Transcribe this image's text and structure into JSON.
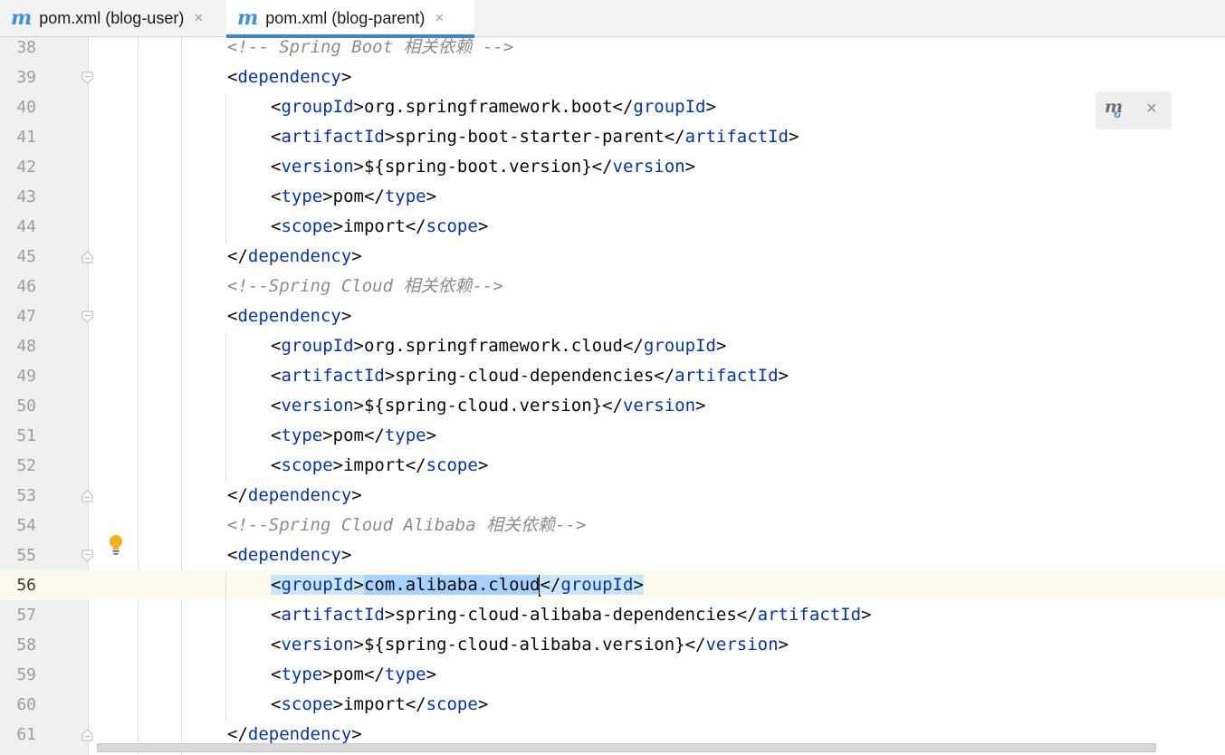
{
  "tabs": [
    {
      "icon": "maven-m-icon",
      "label": "pom.xml (blog-user)",
      "close": "×",
      "active": false
    },
    {
      "icon": "maven-m-icon",
      "label": "pom.xml (blog-parent)",
      "close": "×",
      "active": true
    }
  ],
  "maven_popup": {
    "icon": "maven-reload-icon",
    "close": "×"
  },
  "editor": {
    "current_line": 56,
    "lines": [
      {
        "n": "38",
        "parts": [
          {
            "t": "<!-- Spring Boot 相关依赖 -->",
            "c": "cm"
          }
        ]
      },
      {
        "n": "39",
        "parts": [
          {
            "t": "<",
            "c": ""
          },
          {
            "t": "dependency",
            "c": "t"
          },
          {
            "t": ">",
            "c": ""
          }
        ]
      },
      {
        "n": "40",
        "parts": [
          {
            "t": "<",
            "c": ""
          },
          {
            "t": "groupId",
            "c": "t"
          },
          {
            "t": ">org.springframework.boot</",
            "c": ""
          },
          {
            "t": "groupId",
            "c": "t"
          },
          {
            "t": ">",
            "c": ""
          }
        ]
      },
      {
        "n": "41",
        "parts": [
          {
            "t": "<",
            "c": ""
          },
          {
            "t": "artifactId",
            "c": "t"
          },
          {
            "t": ">spring-boot-starter-parent</",
            "c": ""
          },
          {
            "t": "artifactId",
            "c": "t"
          },
          {
            "t": ">",
            "c": ""
          }
        ]
      },
      {
        "n": "42",
        "parts": [
          {
            "t": "<",
            "c": ""
          },
          {
            "t": "version",
            "c": "t"
          },
          {
            "t": ">${spring-boot.version}</",
            "c": ""
          },
          {
            "t": "version",
            "c": "t"
          },
          {
            "t": ">",
            "c": ""
          }
        ]
      },
      {
        "n": "43",
        "parts": [
          {
            "t": "<",
            "c": ""
          },
          {
            "t": "type",
            "c": "t"
          },
          {
            "t": ">pom</",
            "c": ""
          },
          {
            "t": "type",
            "c": "t"
          },
          {
            "t": ">",
            "c": ""
          }
        ]
      },
      {
        "n": "44",
        "parts": [
          {
            "t": "<",
            "c": ""
          },
          {
            "t": "scope",
            "c": "t"
          },
          {
            "t": ">import</",
            "c": ""
          },
          {
            "t": "scope",
            "c": "t"
          },
          {
            "t": ">",
            "c": ""
          }
        ]
      },
      {
        "n": "45",
        "parts": [
          {
            "t": "</",
            "c": ""
          },
          {
            "t": "dependency",
            "c": "t"
          },
          {
            "t": ">",
            "c": ""
          }
        ]
      },
      {
        "n": "46",
        "parts": [
          {
            "t": "<!--Spring Cloud 相关依赖-->",
            "c": "cm"
          }
        ]
      },
      {
        "n": "47",
        "parts": [
          {
            "t": "<",
            "c": ""
          },
          {
            "t": "dependency",
            "c": "t"
          },
          {
            "t": ">",
            "c": ""
          }
        ]
      },
      {
        "n": "48",
        "parts": [
          {
            "t": "<",
            "c": ""
          },
          {
            "t": "groupId",
            "c": "t"
          },
          {
            "t": ">org.springframework.cloud</",
            "c": ""
          },
          {
            "t": "groupId",
            "c": "t"
          },
          {
            "t": ">",
            "c": ""
          }
        ]
      },
      {
        "n": "49",
        "parts": [
          {
            "t": "<",
            "c": ""
          },
          {
            "t": "artifactId",
            "c": "t"
          },
          {
            "t": ">spring-cloud-dependencies</",
            "c": ""
          },
          {
            "t": "artifactId",
            "c": "t"
          },
          {
            "t": ">",
            "c": ""
          }
        ]
      },
      {
        "n": "50",
        "parts": [
          {
            "t": "<",
            "c": ""
          },
          {
            "t": "version",
            "c": "t"
          },
          {
            "t": ">${spring-cloud.version}</",
            "c": ""
          },
          {
            "t": "version",
            "c": "t"
          },
          {
            "t": ">",
            "c": ""
          }
        ]
      },
      {
        "n": "51",
        "parts": [
          {
            "t": "<",
            "c": ""
          },
          {
            "t": "type",
            "c": "t"
          },
          {
            "t": ">pom</",
            "c": ""
          },
          {
            "t": "type",
            "c": "t"
          },
          {
            "t": ">",
            "c": ""
          }
        ]
      },
      {
        "n": "52",
        "parts": [
          {
            "t": "<",
            "c": ""
          },
          {
            "t": "scope",
            "c": "t"
          },
          {
            "t": ">import</",
            "c": ""
          },
          {
            "t": "scope",
            "c": "t"
          },
          {
            "t": ">",
            "c": ""
          }
        ]
      },
      {
        "n": "53",
        "parts": [
          {
            "t": "</",
            "c": ""
          },
          {
            "t": "dependency",
            "c": "t"
          },
          {
            "t": ">",
            "c": ""
          }
        ]
      },
      {
        "n": "54",
        "parts": [
          {
            "t": "<!--Spring Cloud Alibaba 相关依赖-->",
            "c": "cm"
          }
        ]
      },
      {
        "n": "55",
        "parts": [
          {
            "t": "<",
            "c": ""
          },
          {
            "t": "dependency",
            "c": "t"
          },
          {
            "t": ">",
            "c": ""
          }
        ]
      },
      {
        "n": "56",
        "parts": [
          {
            "t": "<",
            "c": "tag-hl"
          },
          {
            "t": "groupId",
            "c": "t tag-hl"
          },
          {
            "t": ">",
            "c": "tag-hl"
          },
          {
            "t": "com.alibaba.cloud",
            "c": "sel"
          },
          {
            "t": "",
            "c": "caret"
          },
          {
            "t": "</",
            "c": "tag-hl"
          },
          {
            "t": "groupId",
            "c": "t tag-hl"
          },
          {
            "t": ">",
            "c": "tag-hl"
          }
        ]
      },
      {
        "n": "57",
        "parts": [
          {
            "t": "<",
            "c": ""
          },
          {
            "t": "artifactId",
            "c": "t"
          },
          {
            "t": ">spring-cloud-alibaba-dependencies</",
            "c": ""
          },
          {
            "t": "artifactId",
            "c": "t"
          },
          {
            "t": ">",
            "c": ""
          }
        ]
      },
      {
        "n": "58",
        "parts": [
          {
            "t": "<",
            "c": ""
          },
          {
            "t": "version",
            "c": "t"
          },
          {
            "t": ">${spring-cloud-alibaba.version}</",
            "c": ""
          },
          {
            "t": "version",
            "c": "t"
          },
          {
            "t": ">",
            "c": ""
          }
        ]
      },
      {
        "n": "59",
        "parts": [
          {
            "t": "<",
            "c": ""
          },
          {
            "t": "type",
            "c": "t"
          },
          {
            "t": ">pom</",
            "c": ""
          },
          {
            "t": "type",
            "c": "t"
          },
          {
            "t": ">",
            "c": ""
          }
        ]
      },
      {
        "n": "60",
        "parts": [
          {
            "t": "<",
            "c": ""
          },
          {
            "t": "scope",
            "c": "t"
          },
          {
            "t": ">import</",
            "c": ""
          },
          {
            "t": "scope",
            "c": "t"
          },
          {
            "t": ">",
            "c": ""
          }
        ]
      },
      {
        "n": "61",
        "parts": [
          {
            "t": "</",
            "c": ""
          },
          {
            "t": "dependency",
            "c": "t"
          },
          {
            "t": ">",
            "c": ""
          }
        ]
      }
    ]
  }
}
